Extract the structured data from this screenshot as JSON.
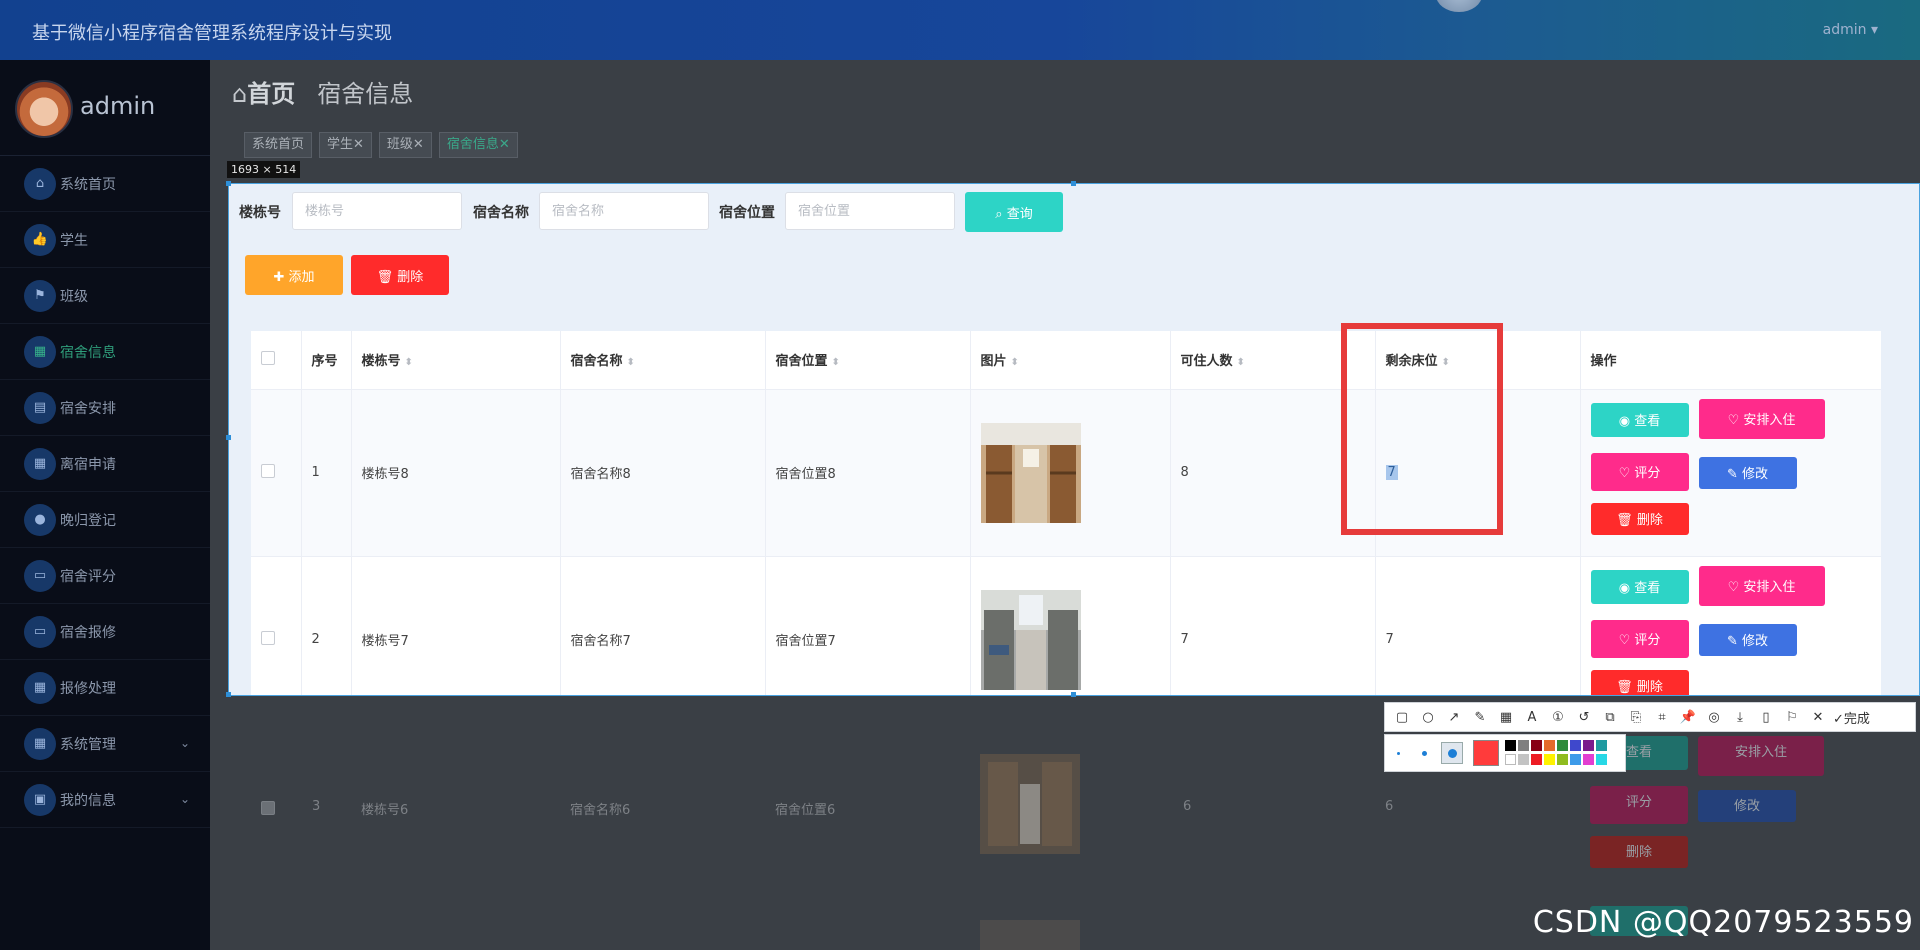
{
  "header": {
    "title": "基于微信小程序宿舍管理系统程序设计与实现",
    "user": "admin ▾"
  },
  "sidebar": {
    "username": "admin",
    "items": [
      {
        "label": "系统首页",
        "icon": "home-icon",
        "glyph": "⌂"
      },
      {
        "label": "学生",
        "icon": "thumbs-up-icon",
        "glyph": "👍"
      },
      {
        "label": "班级",
        "icon": "flag-icon",
        "glyph": "⚑"
      },
      {
        "label": "宿舍信息",
        "icon": "grid-icon",
        "glyph": "▦"
      },
      {
        "label": "宿舍安排",
        "icon": "clipboard-icon",
        "glyph": "▤"
      },
      {
        "label": "离宿申请",
        "icon": "table-icon",
        "glyph": "▦"
      },
      {
        "label": "晚归登记",
        "icon": "user-icon",
        "glyph": "●"
      },
      {
        "label": "宿舍评分",
        "icon": "chat-icon",
        "glyph": "▭"
      },
      {
        "label": "宿舍报修",
        "icon": "monitor-icon",
        "glyph": "▭"
      },
      {
        "label": "报修处理",
        "icon": "apps-icon",
        "glyph": "▦"
      },
      {
        "label": "系统管理",
        "icon": "apps-icon",
        "glyph": "▦"
      },
      {
        "label": "我的信息",
        "icon": "card-icon",
        "glyph": "▣"
      }
    ]
  },
  "page": {
    "home": "首页",
    "title": "宿舍信息"
  },
  "tags": [
    "系统首页",
    "学生✕",
    "班级✕",
    "宿舍信息✕"
  ],
  "selection_size": "1693 × 514",
  "search": {
    "label_building": "楼栋号",
    "placeholder_building": "楼栋号",
    "label_name": "宿舍名称",
    "placeholder_name": "宿舍名称",
    "label_location": "宿舍位置",
    "placeholder_location": "宿舍位置",
    "button": "查询"
  },
  "ops": {
    "add": "✚ 添加",
    "delete": "🗑 删除"
  },
  "table": {
    "headers": [
      "序号",
      "楼栋号",
      "宿舍名称",
      "宿舍位置",
      "图片",
      "可住人数",
      "剩余床位",
      "操作"
    ],
    "rows": [
      {
        "index": "1",
        "building": "楼栋号8",
        "name": "宿舍名称8",
        "location": "宿舍位置8",
        "capacity": "8",
        "beds": "7"
      },
      {
        "index": "2",
        "building": "楼栋号7",
        "name": "宿舍名称7",
        "location": "宿舍位置7",
        "capacity": "7",
        "beds": "7"
      },
      {
        "index": "3",
        "building": "楼栋号6",
        "name": "宿舍名称6",
        "location": "宿舍位置6",
        "capacity": "6",
        "beds": "6"
      }
    ],
    "actions": {
      "view": "查看",
      "arrange": "安排入住",
      "rate": "评分",
      "edit": "修改",
      "delete": "删除"
    }
  },
  "toolbar": {
    "done": "完成"
  },
  "watermark": "CSDN @QQ2079523559",
  "colors": {
    "teal": "#2dd4c6",
    "pink": "#ff2b8b",
    "blue": "#3e72e2",
    "red": "#ff2b2b",
    "orange": "#ffa52a"
  }
}
